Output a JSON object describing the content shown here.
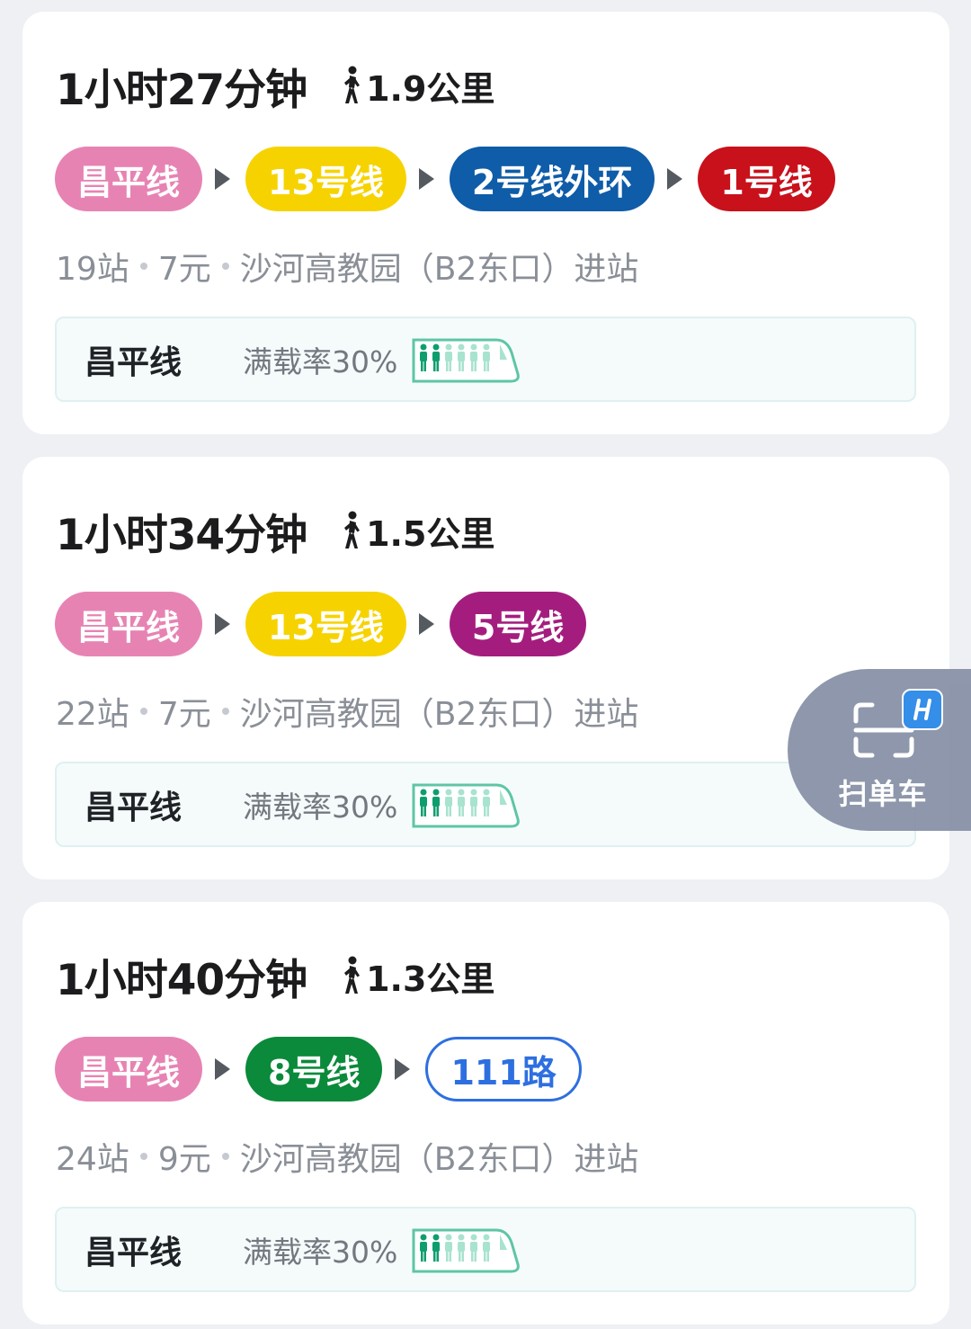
{
  "routes": [
    {
      "duration": "1小时27分钟",
      "walk_distance": "1.9公里",
      "lines": [
        {
          "label": "昌平线",
          "color": "#e783b3"
        },
        {
          "label": "13号线",
          "color": "#f6d300"
        },
        {
          "label": "2号线外环",
          "color": "#0f5ca8"
        },
        {
          "label": "1号线",
          "color": "#c8111b"
        }
      ],
      "stations": "19站",
      "fare": "7元",
      "entry": "沙河高教园（B2东口）进站",
      "crowd": {
        "line": "昌平线",
        "rate_text": "满载率30%",
        "load_fraction": 0.3
      }
    },
    {
      "duration": "1小时34分钟",
      "walk_distance": "1.5公里",
      "lines": [
        {
          "label": "昌平线",
          "color": "#e783b3"
        },
        {
          "label": "13号线",
          "color": "#f6d300"
        },
        {
          "label": "5号线",
          "color": "#a41d7e"
        }
      ],
      "stations": "22站",
      "fare": "7元",
      "entry": "沙河高教园（B2东口）进站",
      "crowd": {
        "line": "昌平线",
        "rate_text": "满载率30%",
        "load_fraction": 0.3
      }
    },
    {
      "duration": "1小时40分钟",
      "walk_distance": "1.3公里",
      "lines": [
        {
          "label": "昌平线",
          "color": "#e783b3"
        },
        {
          "label": "8号线",
          "color": "#0a8a3a"
        },
        {
          "label": "111路",
          "color": "#2e6fe0",
          "style": "outline"
        }
      ],
      "stations": "24站",
      "fare": "9元",
      "entry": "沙河高教园（B2东口）进站",
      "crowd": {
        "line": "昌平线",
        "rate_text": "满载率30%",
        "load_fraction": 0.3
      }
    }
  ],
  "scan_bike": {
    "label": "扫单车",
    "icon": "scan-bike-icon"
  }
}
